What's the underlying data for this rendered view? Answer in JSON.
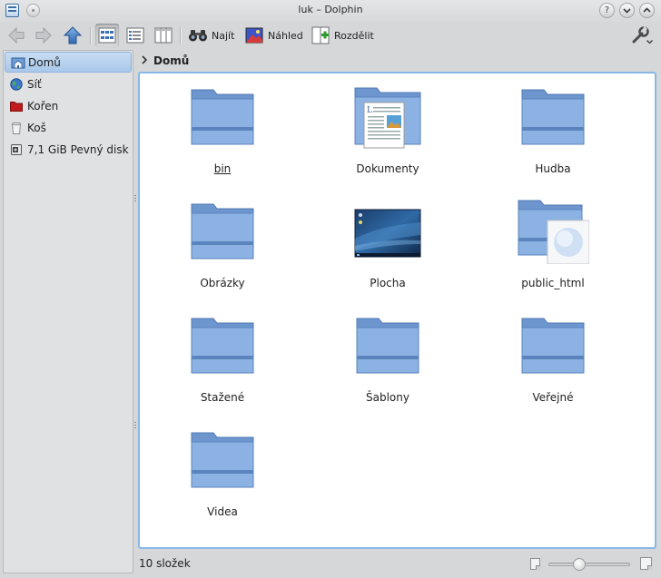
{
  "window": {
    "title": "luk – Dolphin",
    "buttons": [
      "help",
      "minimize",
      "maximize",
      "close"
    ]
  },
  "toolbar": {
    "find_label": "Najít",
    "preview_label": "Náhled",
    "split_label": "Rozdělit",
    "view_modes": [
      "icons-view",
      "details-view",
      "columns-view"
    ],
    "active_view": "icons-view"
  },
  "sidebar": {
    "items": [
      {
        "label": "Domů",
        "icon": "home-icon",
        "selected": true
      },
      {
        "label": "Síť",
        "icon": "network-globe-icon",
        "selected": false
      },
      {
        "label": "Kořen",
        "icon": "root-folder-icon",
        "selected": false
      },
      {
        "label": "Koš",
        "icon": "trash-icon",
        "selected": false
      },
      {
        "label": "7,1 GiB Pevný disk",
        "icon": "hard-disk-icon",
        "selected": false
      }
    ]
  },
  "breadcrumb": {
    "separator": ">",
    "current": "Domů"
  },
  "files": [
    {
      "name": "bin",
      "type": "folder",
      "underlined": true
    },
    {
      "name": "Dokumenty",
      "type": "documents-folder"
    },
    {
      "name": "Hudba",
      "type": "folder"
    },
    {
      "name": "Obrázky",
      "type": "folder"
    },
    {
      "name": "Plocha",
      "type": "desktop"
    },
    {
      "name": "public_html",
      "type": "web-folder"
    },
    {
      "name": "Stažené",
      "type": "folder"
    },
    {
      "name": "Šablony",
      "type": "folder"
    },
    {
      "name": "Veřejné",
      "type": "folder"
    },
    {
      "name": "Videa",
      "type": "folder"
    }
  ],
  "status": {
    "text": "10 složek",
    "zoom_level": 0.35
  },
  "colors": {
    "accent": "#87b8e8",
    "folder": "#7ba3d8",
    "selection": "#a9c8ea"
  }
}
